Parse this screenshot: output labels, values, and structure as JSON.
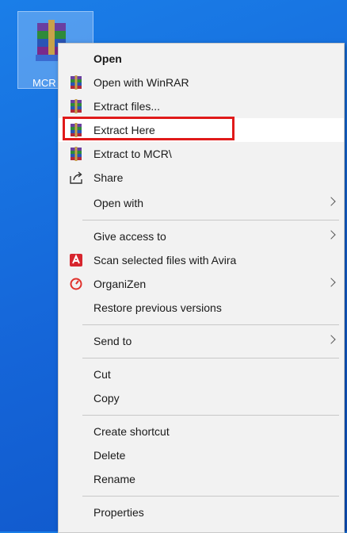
{
  "desktop": {
    "icon_label": "MCR",
    "icon_name": "winrar-archive-icon"
  },
  "menu": {
    "open": "Open",
    "open_with_winrar": "Open with WinRAR",
    "extract_files": "Extract files...",
    "extract_here": "Extract Here",
    "extract_to": "Extract to MCR\\",
    "share": "Share",
    "open_with": "Open with",
    "give_access_to": "Give access to",
    "scan_avira": "Scan selected files with Avira",
    "organizen": "OrganiZen",
    "restore_previous": "Restore previous versions",
    "send_to": "Send to",
    "cut": "Cut",
    "copy": "Copy",
    "create_shortcut": "Create shortcut",
    "delete": "Delete",
    "rename": "Rename",
    "properties": "Properties"
  },
  "colors": {
    "highlight_outline": "#e01a1a",
    "avira_red": "#d7262e",
    "organizen_red": "#e0312b"
  }
}
